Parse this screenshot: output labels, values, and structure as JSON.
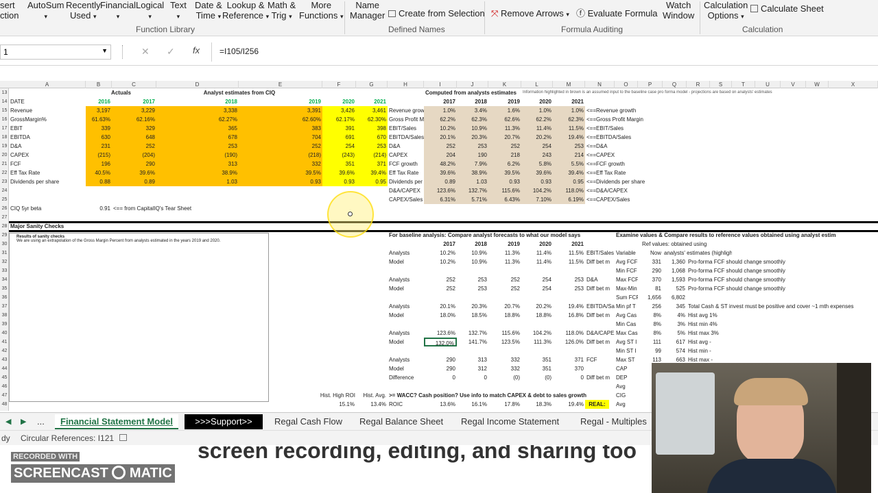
{
  "ribbon": {
    "items": [
      "sert",
      "ction",
      "AutoSum",
      "Recently",
      "Used",
      "Financial",
      "Logical",
      "Text",
      "Date &",
      "Time",
      "Lookup &",
      "Reference",
      "Math &",
      "Trig",
      "More",
      "Functions",
      "Name",
      "Manager",
      "Create from Selection",
      "Remove Arrows",
      "Evaluate Formula",
      "Watch",
      "Window",
      "Calculation",
      "Options",
      "Calculate Sheet"
    ],
    "groups": [
      "Function Library",
      "Defined Names",
      "Formula Auditing",
      "Calculation"
    ]
  },
  "formula_bar": {
    "name_box": "1",
    "cancel": "✕",
    "enter": "✓",
    "fx": "fx",
    "formula": "=I105/I256"
  },
  "columns": [
    "A",
    "B",
    "C",
    "D",
    "E",
    "F",
    "G",
    "H",
    "I",
    "J",
    "K",
    "L",
    "M",
    "N",
    "O",
    "P",
    "Q",
    "R",
    "S",
    "T",
    "U",
    "V",
    "W",
    "X"
  ],
  "rows": [
    "13",
    "14",
    "15",
    "16",
    "17",
    "18",
    "19",
    "20",
    "21",
    "22",
    "23",
    "24",
    "25",
    "26",
    "27",
    "28",
    "29",
    "30",
    "31",
    "32",
    "33",
    "34",
    "35",
    "36",
    "37",
    "38",
    "39",
    "40",
    "41",
    "42",
    "43",
    "44",
    "45",
    "46",
    "47",
    "48"
  ],
  "top_table": {
    "actuals_header": "Actuals",
    "estimates_header": "Analyst estimates from CIQ",
    "years": [
      "2016",
      "2017",
      "2018",
      "2019",
      "2020",
      "2021"
    ],
    "labels": [
      "DATE",
      "Revenue",
      "GrossMargin%",
      "EBIT",
      "EBITDA",
      "D&A",
      "CAPEX",
      "FCF",
      "Eff Tax Rate",
      "Dividends per share"
    ],
    "rows": [
      [
        "3,197",
        "3,229",
        "3,338",
        "3,391",
        "3,426",
        "3,461"
      ],
      [
        "61.63%",
        "62.16%",
        "62.27%",
        "62.60%",
        "62.17%",
        "62.30%"
      ],
      [
        "339",
        "329",
        "365",
        "383",
        "391",
        "398"
      ],
      [
        "630",
        "648",
        "678",
        "704",
        "691",
        "670"
      ],
      [
        "231",
        "252",
        "253",
        "252",
        "254",
        "253"
      ],
      [
        "(215)",
        "(204)",
        "(190)",
        "(218)",
        "(243)",
        "(214)"
      ],
      [
        "196",
        "290",
        "313",
        "332",
        "351",
        "371"
      ],
      [
        "40.5%",
        "39.6%",
        "38.9%",
        "39.5%",
        "39.6%",
        "39.4%"
      ],
      [
        "0.88",
        "0.89",
        "1.03",
        "0.93",
        "0.93",
        "0.95"
      ]
    ],
    "beta_label": "CIQ 5yr beta",
    "beta_value": "0.91",
    "beta_note": "<== from CapitalIQ's Tear Sheet"
  },
  "computed_table": {
    "header": "Computed from analysts estimates",
    "note": "Information highlighted in brown is an assumed input to the baseline case pro forma model - projections are  based on analysts' estimates",
    "years": [
      "2017",
      "2018",
      "2019",
      "2020",
      "2021"
    ],
    "labels": [
      "Revenue grow",
      "Gross Profit M",
      "EBIT/Sales",
      "EBITDA/Sales",
      "D&A",
      "CAPEX",
      "FCF growth",
      "Eff Tax Rate",
      "Dividends per",
      "D&A/CAPEX",
      "CAPEX/Sales"
    ],
    "rows": [
      [
        "1.0%",
        "3.4%",
        "1.6%",
        "1.0%",
        "1.0%"
      ],
      [
        "62.2%",
        "62.3%",
        "62.6%",
        "62.2%",
        "62.3%"
      ],
      [
        "10.2%",
        "10.9%",
        "11.3%",
        "11.4%",
        "11.5%"
      ],
      [
        "20.1%",
        "20.3%",
        "20.7%",
        "20.2%",
        "19.4%"
      ],
      [
        "252",
        "253",
        "252",
        "254",
        "253"
      ],
      [
        "204",
        "190",
        "218",
        "243",
        "214"
      ],
      [
        "48.2%",
        "7.9%",
        "6.2%",
        "5.8%",
        "5.5%"
      ],
      [
        "39.6%",
        "38.9%",
        "39.5%",
        "39.6%",
        "39.4%"
      ],
      [
        "0.89",
        "1.03",
        "0.93",
        "0.93",
        "0.95"
      ],
      [
        "123.6%",
        "132.7%",
        "115.6%",
        "104.2%",
        "118.0%"
      ],
      [
        "6.31%",
        "5.71%",
        "6.43%",
        "7.10%",
        "6.19%"
      ]
    ],
    "arrows": [
      "<==Revenue growth",
      "<==Gross Profit Margin",
      "<==EBIT/Sales",
      "<==EBITDA/Sales",
      "<==D&A",
      "<==CAPEX",
      "<==FCF growth",
      "<==Eff Tax Rate",
      "<==Dividends per share",
      "<==D&A/CAPEX",
      "<==CAPEX/Sales"
    ]
  },
  "sanity": {
    "header": "Major Sanity Checks",
    "box_title": "Results of sanity checks",
    "box_text": "We are using an extrapolation of the Gross Margin Percent from analysts estimated in the years 2019 and 2020."
  },
  "baseline": {
    "header": "For baseline analysis: Compare analyst forecasts to what our model says",
    "years": [
      "2017",
      "2018",
      "2019",
      "2020",
      "2021"
    ],
    "rows": [
      {
        "label": "Analysts",
        "vals": [
          "10.2%",
          "10.9%",
          "11.3%",
          "11.4%",
          "11.5%"
        ],
        "note": "EBIT/Sales"
      },
      {
        "label": "Model",
        "vals": [
          "10.2%",
          "10.9%",
          "11.3%",
          "11.4%",
          "11.5%"
        ],
        "note": "Diff bet m"
      },
      {
        "label": "",
        "vals": [
          "",
          "",
          "",
          "",
          ""
        ],
        "note": ""
      },
      {
        "label": "Analysts",
        "vals": [
          "252",
          "253",
          "252",
          "254",
          "253"
        ],
        "note": "D&A"
      },
      {
        "label": "Model",
        "vals": [
          "252",
          "253",
          "252",
          "254",
          "253"
        ],
        "note": "Diff bet m"
      },
      {
        "label": "",
        "vals": [
          "",
          "",
          "",
          "",
          ""
        ],
        "note": ""
      },
      {
        "label": "Analysts",
        "vals": [
          "20.1%",
          "20.3%",
          "20.7%",
          "20.2%",
          "19.4%"
        ],
        "note": "EBITDA/Sales"
      },
      {
        "label": "Model",
        "vals": [
          "18.0%",
          "18.5%",
          "18.8%",
          "18.8%",
          "16.8%"
        ],
        "note": "Diff bet m"
      },
      {
        "label": "",
        "vals": [
          "",
          "",
          "",
          "",
          ""
        ],
        "note": ""
      },
      {
        "label": "Analysts",
        "vals": [
          "123.6%",
          "132.7%",
          "115.6%",
          "104.2%",
          "118.0%"
        ],
        "note": "D&A/CAPEX"
      },
      {
        "label": "Model",
        "vals": [
          "132.0%",
          "141.7%",
          "123.5%",
          "111.3%",
          "126.0%"
        ],
        "note": "Diff bet m"
      },
      {
        "label": "",
        "vals": [
          "",
          "",
          "",
          "",
          ""
        ],
        "note": ""
      },
      {
        "label": "Analysts",
        "vals": [
          "290",
          "313",
          "332",
          "351",
          "371"
        ],
        "note": "FCF"
      },
      {
        "label": "Model",
        "vals": [
          "290",
          "312",
          "332",
          "351",
          "370"
        ],
        "note": ""
      },
      {
        "label": "Difference",
        "vals": [
          "0",
          "0",
          "(0)",
          "(0)",
          "0"
        ],
        "note": "Diff bet m"
      }
    ],
    "roic_header": ">= WACC? Cash position? Use info to match CAPEX & debt to sales growth",
    "hist_high": "Hist. High ROI",
    "hist_avg": "Hist. Avg.",
    "hist_high_val": "15.1%",
    "hist_avg_val": "13.4%",
    "roic_label": "ROIC",
    "roic_vals": [
      "13.6%",
      "16.1%",
      "17.8%",
      "18.3%",
      "19.4%"
    ],
    "real_tag": "REAL:"
  },
  "examine": {
    "header": "Examine values & Compare results to reference values obtained using analyst estim",
    "ref_note": "Ref values: obtained using",
    "ref_note2": "analysts' estimates (highlighted in brown)",
    "col_var": "Variable",
    "col_now": "Now",
    "rows": [
      {
        "var": "Avg FCF",
        "now": "331",
        "ref": "1,360",
        "note": "Pro-forma FCF should change smoothly"
      },
      {
        "var": "Min FCF",
        "now": "290",
        "ref": "1,068",
        "note": "Pro-forma FCF should change smoothly"
      },
      {
        "var": "Max FCF",
        "now": "370",
        "ref": "1,593",
        "note": "Pro-forma FCF should change smoothly"
      },
      {
        "var": "Max-Min",
        "now": "81",
        "ref": "525",
        "note": "Pro-forma FCF should change smoothly"
      },
      {
        "var": "Sum FCF",
        "now": "1,656",
        "ref": "6,802",
        "note": ""
      },
      {
        "var": "Min pf T",
        "now": "256",
        "ref": "345",
        "note": "Total Cash & ST invest must be positive and cover ~1 mth expenses"
      },
      {
        "var": "Avg Cas",
        "now": "8%",
        "ref": "4%",
        "note": "Hist avg       1%"
      },
      {
        "var": "Min Cas",
        "now": "8%",
        "ref": "3%",
        "note": "Hist min       4%"
      },
      {
        "var": "Max Cas",
        "now": "8%",
        "ref": "5%",
        "note": "Hist max       3%"
      },
      {
        "var": "Avg ST I",
        "now": "111",
        "ref": "617",
        "note": "Hist avg       -"
      },
      {
        "var": "Min ST I",
        "now": "99",
        "ref": "574",
        "note": "Hist min       -"
      },
      {
        "var": "Max ST",
        "now": "113",
        "ref": "663",
        "note": "Hist max       -"
      },
      {
        "var": "CAP",
        "now": "",
        "ref": "",
        "note": ""
      },
      {
        "var": "DEP",
        "now": "",
        "ref": "",
        "note": ""
      },
      {
        "var": "Avg",
        "now": "",
        "ref": "",
        "note": ""
      },
      {
        "var": "CIG",
        "now": "",
        "ref": "",
        "note": ""
      },
      {
        "var": "Avg",
        "now": "",
        "ref": "",
        "note": ""
      }
    ]
  },
  "tabs": [
    "...",
    "Financial Statement Model",
    ">>>Support>>",
    "Regal Cash Flow",
    "Regal Balance Sheet",
    "Regal Income Statement",
    "Regal - Multiples"
  ],
  "status": {
    "ready": "dy",
    "circular": "Circular References: I121"
  },
  "caption": {
    "text": "screen recording, editing, and sharing too",
    "recorded_with": "RECORDED WITH",
    "brand1": "SCREENCAST",
    "brand2": "MATIC"
  },
  "colors": {
    "orange": "#FFC000",
    "yellow": "#FFFF00",
    "tan": "#E6D8C3",
    "green": "#00B050",
    "tab_green": "#217346"
  }
}
